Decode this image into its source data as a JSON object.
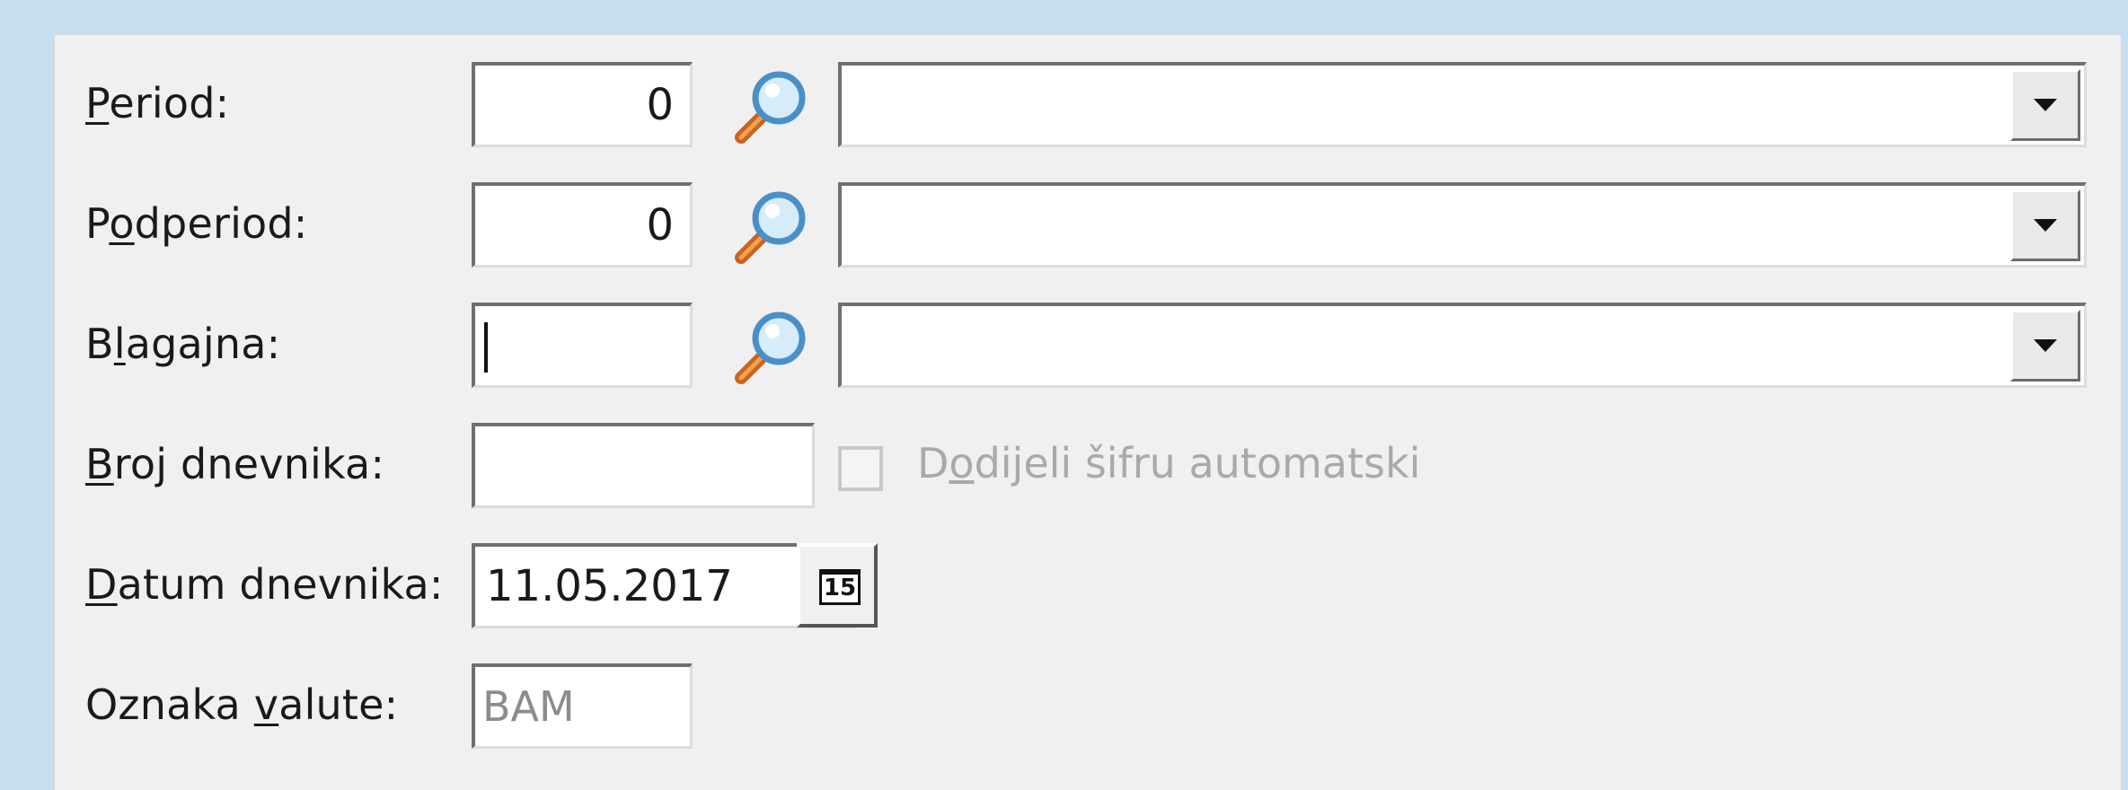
{
  "form": {
    "period": {
      "label_accel": "P",
      "label_rest": "eriod:",
      "value": "0"
    },
    "podperiod": {
      "label_pre": "P",
      "label_accel": "o",
      "label_rest": "dperiod:",
      "value": "0"
    },
    "blagajna": {
      "label_pre": "B",
      "label_accel": "l",
      "label_rest": "agajna:",
      "value": ""
    },
    "broj_dnevnika": {
      "label_accel": "B",
      "label_rest": "roj dnevnika:",
      "value": "",
      "checkbox_pre": "D",
      "checkbox_accel": "o",
      "checkbox_rest": "dijeli šifru automatski",
      "checkbox_checked": false
    },
    "datum_dnevnika": {
      "label_accel": "D",
      "label_rest": "atum dnevnika:",
      "value": "11.05.2017",
      "calendar_icon_text": "15"
    },
    "oznaka_valute": {
      "label_pre": "Oznaka ",
      "label_accel": "v",
      "label_rest": "alute:",
      "value": "BAM"
    }
  },
  "icons": {
    "lookup": "magnifier-icon",
    "dropdown": "chevron-down-icon",
    "calendar": "calendar-icon"
  },
  "colors": {
    "window_bg": "#c5dff0",
    "panel_bg": "#f0f0f0",
    "disabled_text": "#a9a9a9"
  }
}
